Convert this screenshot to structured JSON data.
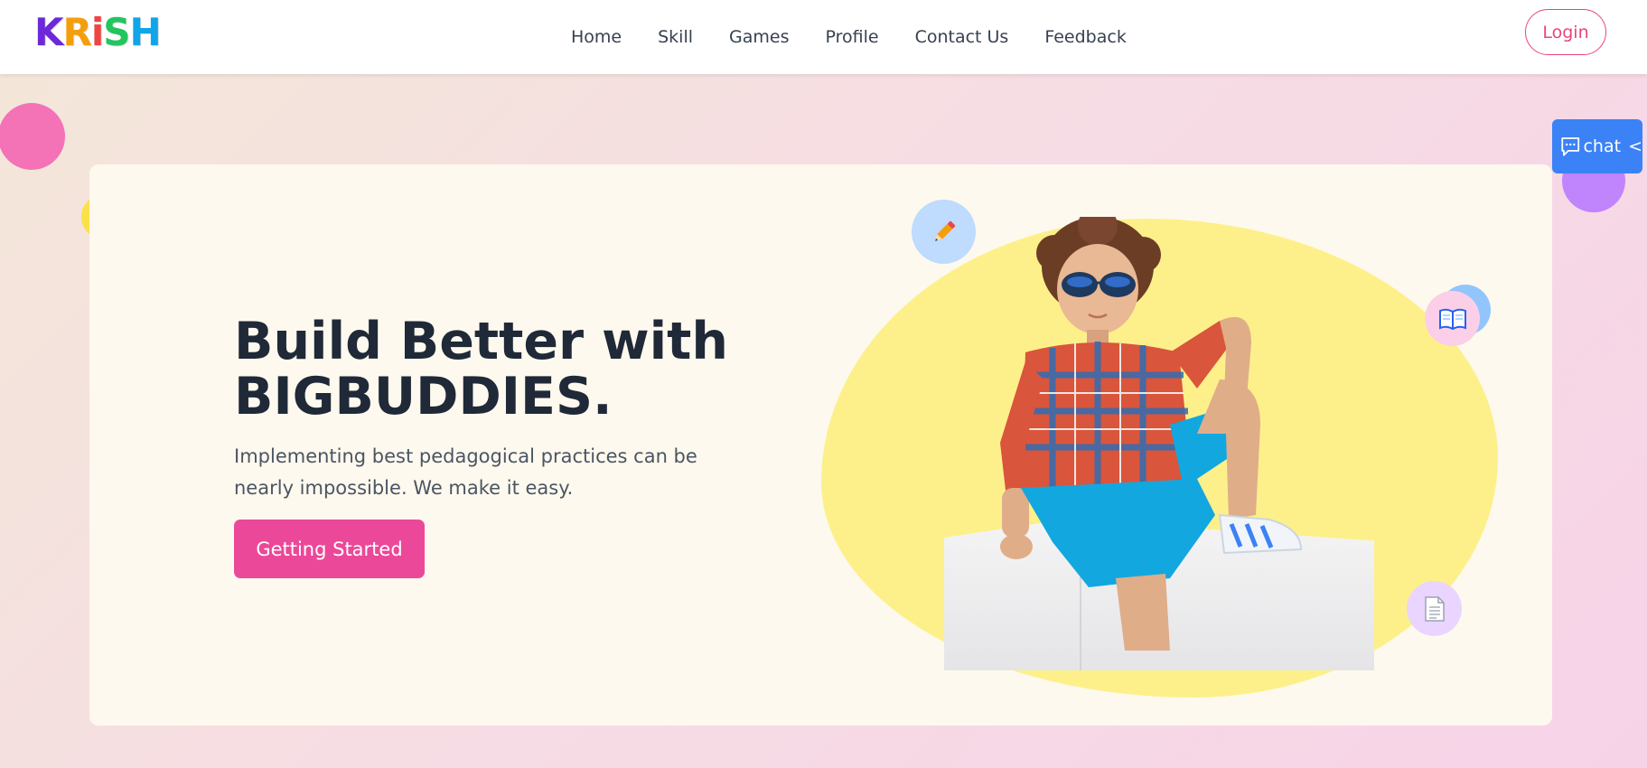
{
  "header": {
    "logo_letters": [
      {
        "char": "K",
        "color": "#6d28d9"
      },
      {
        "char": "R",
        "color": "#f59e0b"
      },
      {
        "char": "i",
        "color": "#ef4444"
      },
      {
        "char": "S",
        "color": "#22c55e"
      },
      {
        "char": "H",
        "color": "#0ea5e9"
      }
    ],
    "nav": [
      {
        "label": "Home"
      },
      {
        "label": "Skill"
      },
      {
        "label": "Games"
      },
      {
        "label": "Profile"
      },
      {
        "label": "Contact Us"
      },
      {
        "label": "Feedback"
      }
    ],
    "login_label": "Login"
  },
  "chat": {
    "label": "chat",
    "arrow": "<",
    "icon": "chat-bubble-icon"
  },
  "hero": {
    "title_line1": "Build Better with",
    "title_line2": "BIGBUDDIES.",
    "subtitle": "Implementing best pedagogical practices can be nearly impossible. We make it easy.",
    "cta_label": "Getting Started"
  },
  "illustration": {
    "icons": [
      "pencil-icon",
      "book-icon",
      "document-icon"
    ],
    "blob_color": "#fdf08a"
  },
  "colors": {
    "accent": "#ec4899",
    "chat_blue": "#3b82f6",
    "card_bg": "#fef9ee"
  }
}
